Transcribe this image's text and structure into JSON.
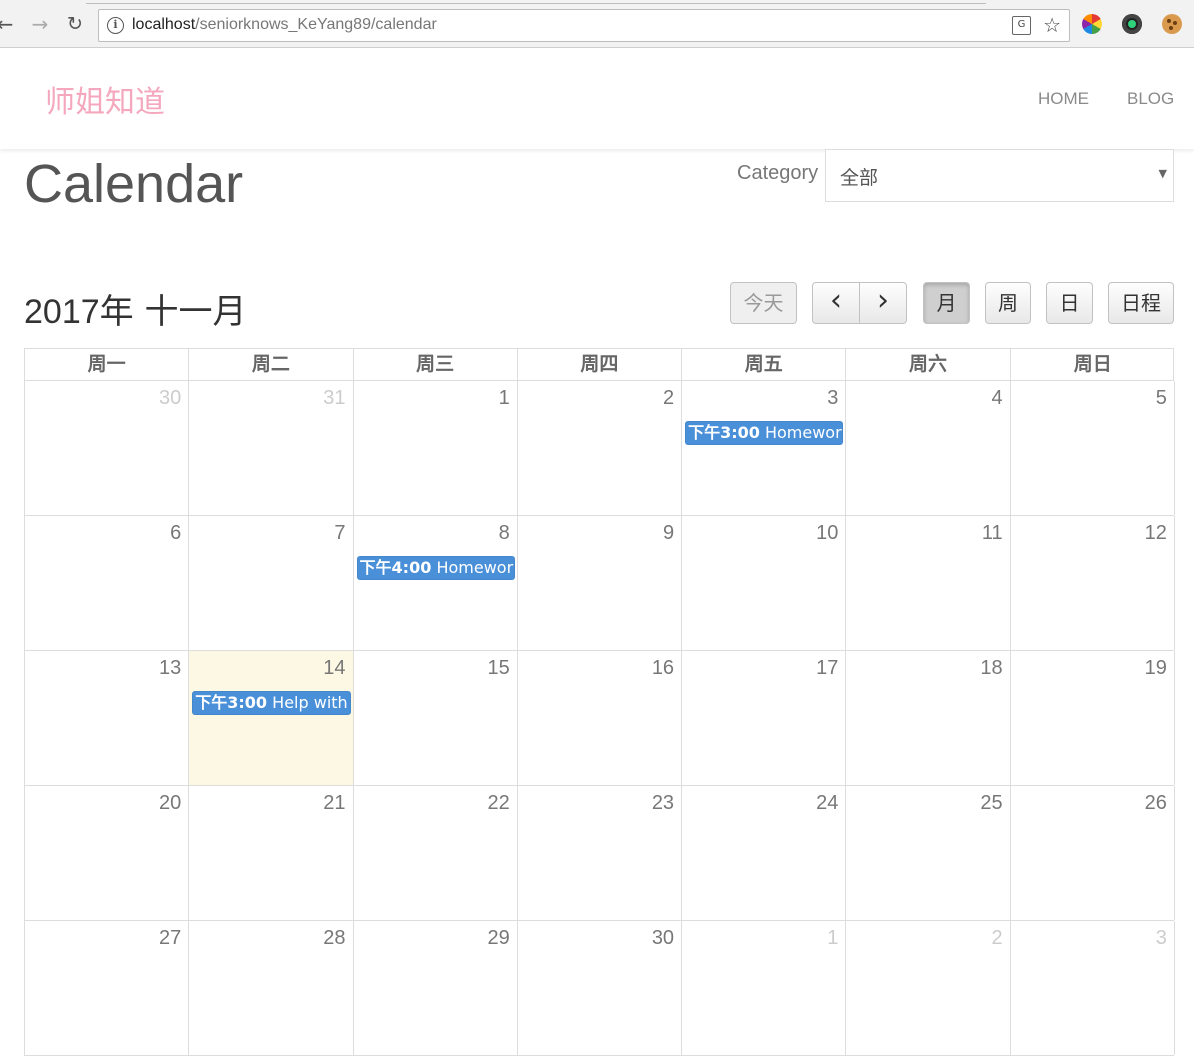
{
  "browser": {
    "url_host": "localhost",
    "url_path": "/seniorknows_KeYang89/calendar"
  },
  "header": {
    "brand": "师姐知道",
    "nav": [
      "HOME",
      "BLOG"
    ]
  },
  "page": {
    "title": "Calendar",
    "category_label": "Category",
    "category_value": "全部"
  },
  "calendar": {
    "month_year": "2017年",
    "month_name": "十一月",
    "buttons": {
      "today": "今天",
      "prev": "‹",
      "next": "›",
      "month": "月",
      "week": "周",
      "day": "日",
      "agenda": "日程"
    },
    "weekdays": [
      "周一",
      "周二",
      "周三",
      "周四",
      "周五",
      "周六",
      "周日"
    ],
    "weeks": [
      [
        {
          "d": "30",
          "other": true
        },
        {
          "d": "31",
          "other": true
        },
        {
          "d": "1"
        },
        {
          "d": "2"
        },
        {
          "d": "3",
          "event": {
            "time": "下午3:00",
            "title": "Homework"
          }
        },
        {
          "d": "4"
        },
        {
          "d": "5"
        }
      ],
      [
        {
          "d": "6"
        },
        {
          "d": "7"
        },
        {
          "d": "8",
          "event": {
            "time": "下午4:00",
            "title": "Homework"
          }
        },
        {
          "d": "9"
        },
        {
          "d": "10"
        },
        {
          "d": "11"
        },
        {
          "d": "12"
        }
      ],
      [
        {
          "d": "13"
        },
        {
          "d": "14",
          "today": true,
          "event": {
            "time": "下午3:00",
            "title": "Help with c"
          }
        },
        {
          "d": "15"
        },
        {
          "d": "16"
        },
        {
          "d": "17"
        },
        {
          "d": "18"
        },
        {
          "d": "19"
        }
      ],
      [
        {
          "d": "20"
        },
        {
          "d": "21"
        },
        {
          "d": "22"
        },
        {
          "d": "23"
        },
        {
          "d": "24"
        },
        {
          "d": "25"
        },
        {
          "d": "26"
        }
      ],
      [
        {
          "d": "27"
        },
        {
          "d": "28"
        },
        {
          "d": "29"
        },
        {
          "d": "30"
        },
        {
          "d": "1",
          "other": true
        },
        {
          "d": "2",
          "other": true
        },
        {
          "d": "3",
          "other": true
        }
      ]
    ]
  }
}
